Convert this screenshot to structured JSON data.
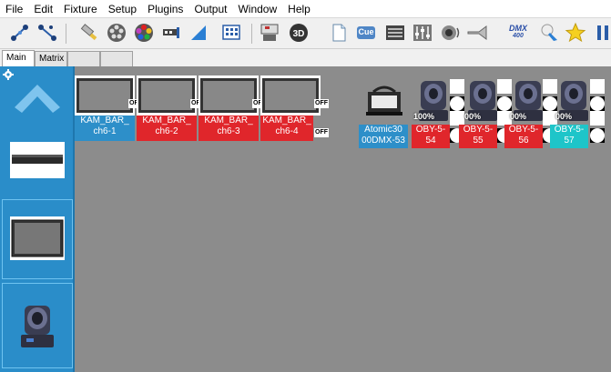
{
  "menu": [
    "File",
    "Edit",
    "Fixture",
    "Setup",
    "Plugins",
    "Output",
    "Window",
    "Help"
  ],
  "toolbar_icons": [
    "fixture-add-icon",
    "fixture-remove-icon",
    "fixture-tool-icon",
    "color-wheel-icon",
    "palette-icon",
    "gobo-icon",
    "beam-icon",
    "grid-icon",
    "console-icon",
    "3d-view-icon",
    "document-icon",
    "cue-icon",
    "fader-icon",
    "mixer-icon",
    "speaker-icon",
    "trumpet-icon",
    "dmx-icon",
    "spotlight-icon",
    "star-icon",
    "pause-icon"
  ],
  "toolbar": {
    "cue_label": "Cue",
    "dmx_label": "DMX",
    "dmx_sub": "400"
  },
  "tabs": [
    {
      "label": "Main",
      "active": true
    },
    {
      "label": "Matrix",
      "active": false
    },
    {
      "label": "",
      "active": false
    },
    {
      "label": "",
      "active": false
    }
  ],
  "bars": [
    {
      "name": "KAM_BAR_ch6-1",
      "line1": "KAM_BAR_",
      "line2": "ch6-1",
      "color": "#2d8fc9",
      "state": "OFF"
    },
    {
      "name": "KAM_BAR_ch6-2",
      "line1": "KAM_BAR_",
      "line2": "ch6-2",
      "color": "#e0262b",
      "state": "OFF"
    },
    {
      "name": "KAM_BAR_ch6-3",
      "line1": "KAM_BAR_",
      "line2": "ch6-3",
      "color": "#e0262b",
      "state": "OFF"
    },
    {
      "name": "KAM_BAR_ch6-4",
      "line1": "KAM_BAR_",
      "line2": "ch6-4",
      "color": "#e0262b",
      "state": "OFF"
    }
  ],
  "strobe": {
    "line1": "Atomic30",
    "line2": "00DMX-53",
    "color": "#2d8fc9"
  },
  "moving_heads": [
    {
      "line1": "OBY-5-",
      "line2": "54",
      "pct": "100%",
      "color": "#e0262b"
    },
    {
      "line1": "OBY-5-",
      "line2": "55",
      "pct": "00%",
      "color": "#e0262b"
    },
    {
      "line1": "OBY-5-",
      "line2": "56",
      "pct": "00%",
      "color": "#e0262b"
    },
    {
      "line1": "OBY-5-",
      "line2": "57",
      "pct": "00%",
      "color": "#1ec5c9"
    }
  ],
  "off_label": "OFF",
  "off_short": "O"
}
